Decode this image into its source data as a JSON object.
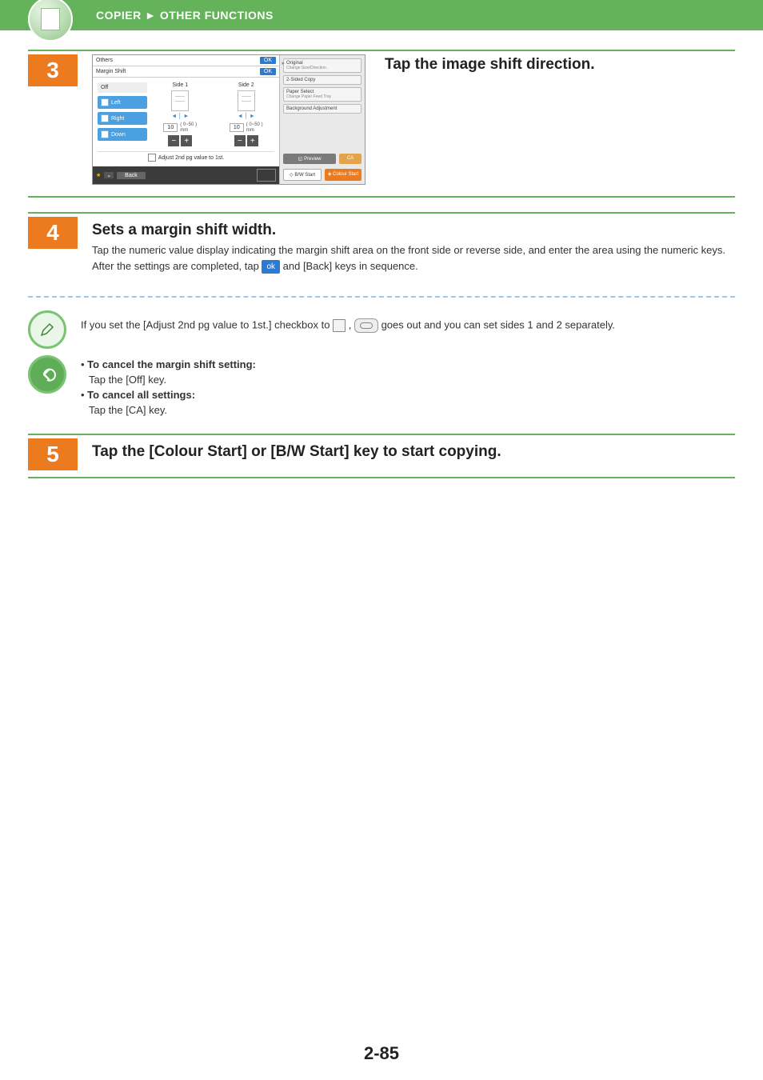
{
  "header": {
    "section": "COPIER",
    "separator": "►",
    "subsection": "OTHER FUNCTIONS"
  },
  "step3": {
    "number": "3",
    "title": "Tap the image shift direction.",
    "mock": {
      "bar1_label": "Others",
      "bar2_label": "Margin Shift",
      "ok": "OK",
      "left_buttons": {
        "off": "Off",
        "left": "Left",
        "right": "Right",
        "down": "Down"
      },
      "side1": "Side 1",
      "side2": "Side 2",
      "value": "10",
      "range": "( 0~50 )",
      "unit": "mm",
      "checkbox_label": "Adjust 2nd pg value to 1st.",
      "back": "Back",
      "side": {
        "original": "Original",
        "original_sub": "Change Size/Direction.",
        "two_sided": "2-Sided Copy",
        "paper": "Paper Select",
        "paper_sub": "Change Paper Feed Tray",
        "bg": "Background Adjustment",
        "preview": "Preview",
        "ca": "CA",
        "bw": "B/W Start",
        "colour": "Colour Start"
      }
    }
  },
  "step4": {
    "number": "4",
    "title": "Sets a margin shift width.",
    "line1": "Tap the numeric value display indicating the margin shift area on the front side or reverse side, and enter the area using the numeric keys.",
    "line2a": "After the settings are completed, tap ",
    "ok_chip": "ok",
    "line2b": " and [Back] keys in sequence."
  },
  "note1": {
    "a": "If you set the [Adjust 2nd pg value to 1st.] checkbox to ",
    "b": " , ",
    "c": " goes out and you can set sides 1 and 2 separately."
  },
  "note2": {
    "b1_head": "To cancel the margin shift setting:",
    "b1_body": "Tap the [Off] key.",
    "b2_head": "To cancel all settings:",
    "b2_body": "Tap the [CA] key."
  },
  "step5": {
    "number": "5",
    "title": "Tap the [Colour Start] or [B/W Start] key to start copying."
  },
  "footer": "2-85"
}
